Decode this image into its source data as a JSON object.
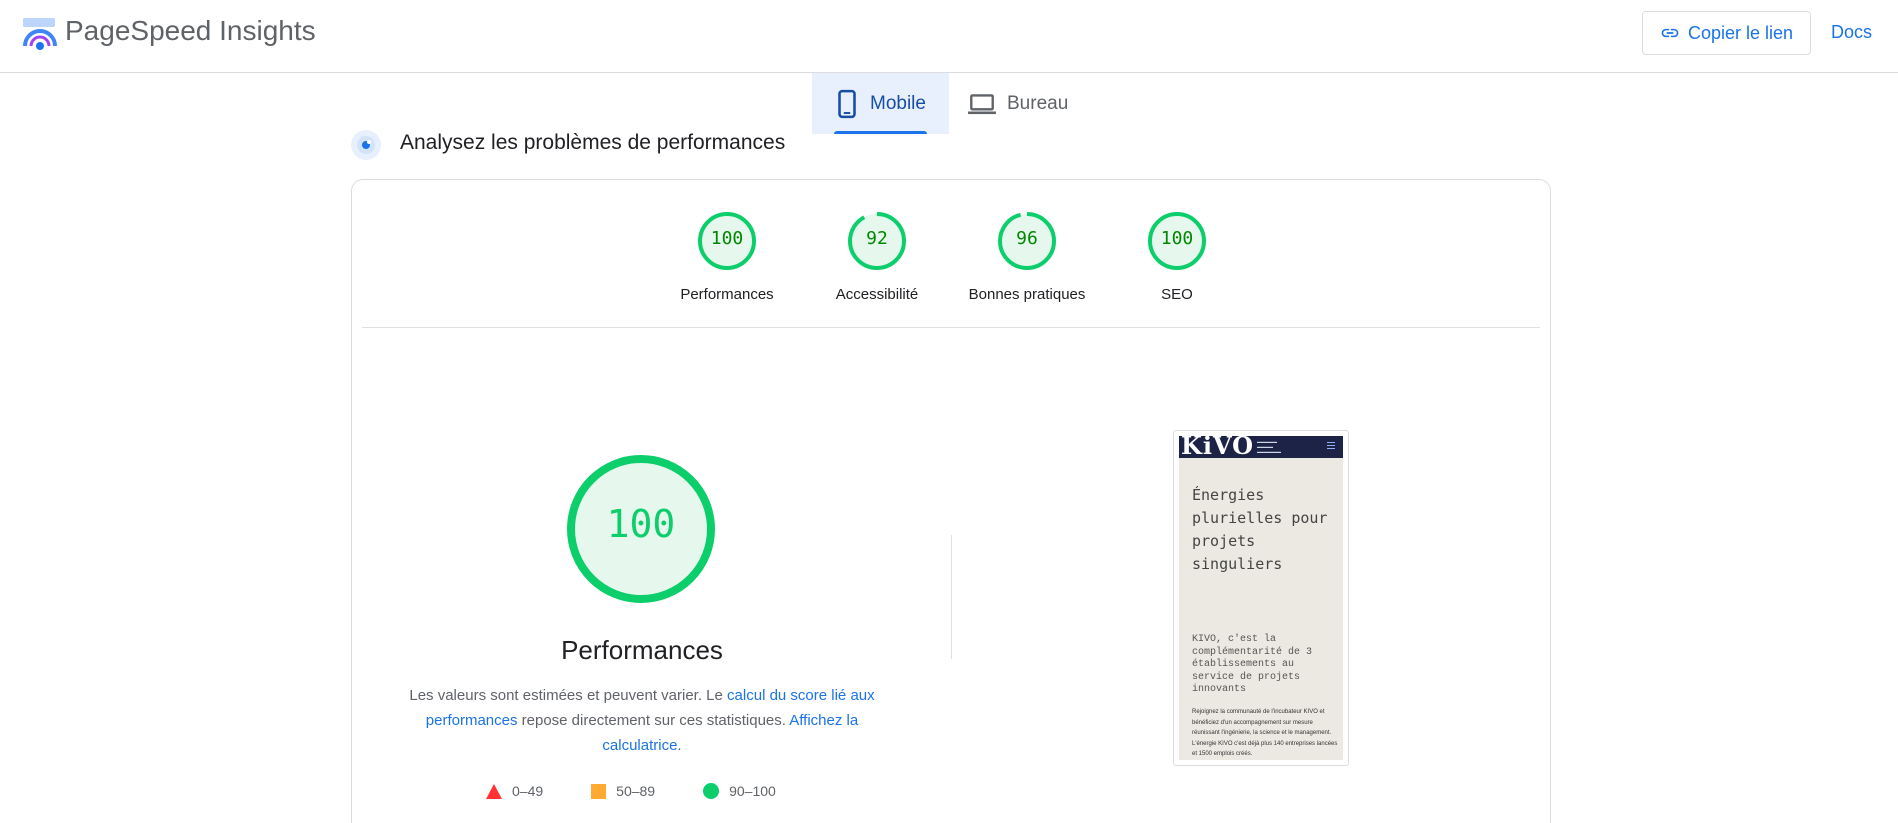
{
  "header": {
    "app_title": "PageSpeed Insights",
    "copy_link_label": "Copier le lien",
    "docs_label": "Docs",
    "logo_icon": "pagespeed-logo-icon",
    "link_icon": "link-icon"
  },
  "tabs": [
    {
      "label": "Mobile",
      "icon": "smartphone-icon",
      "active": true
    },
    {
      "label": "Bureau",
      "icon": "laptop-icon",
      "active": false
    }
  ],
  "section": {
    "title": "Analysez les problèmes de performances",
    "icon": "analyze-target-icon"
  },
  "categories": [
    {
      "label": "Performances",
      "score": 100
    },
    {
      "label": "Accessibilité",
      "score": 92
    },
    {
      "label": "Bonnes pratiques",
      "score": 96
    },
    {
      "label": "SEO",
      "score": 100
    }
  ],
  "performance": {
    "score": 100,
    "title": "Performances",
    "desc_part1": "Les valeurs sont estimées et peuvent varier. Le ",
    "desc_link1": "calcul du score lié aux performances",
    "desc_part2": " repose directement sur ces statistiques. ",
    "desc_link2": "Affichez la calculatrice",
    "desc_part3": "."
  },
  "legend": [
    {
      "shape": "triangle",
      "range": "0–49"
    },
    {
      "shape": "square",
      "range": "50–89"
    },
    {
      "shape": "circle",
      "range": "90–100"
    }
  ],
  "thumbnail": {
    "logo": "KiVO",
    "tagline": "Énergies plurielles pour projets singuliers",
    "intro": "KIVO, c'est la complémentarité de 3 établissements au service de projets innovants",
    "body": "Rejoignez la communauté de l'incubateur KIVO et bénéficiez d'un accompagnement sur mesure réunissant l'ingénierie, la science et le management. L'énergie KIVO c'est déjà plus 140 entreprises lancées et 1500 emplois créés."
  },
  "colors": {
    "pass": "#0cce6b",
    "pass_text": "#008800",
    "pass_fill": "#e6f7ee",
    "average": "#ffaa33",
    "fail": "#ff3333",
    "link": "#1a73e8"
  }
}
